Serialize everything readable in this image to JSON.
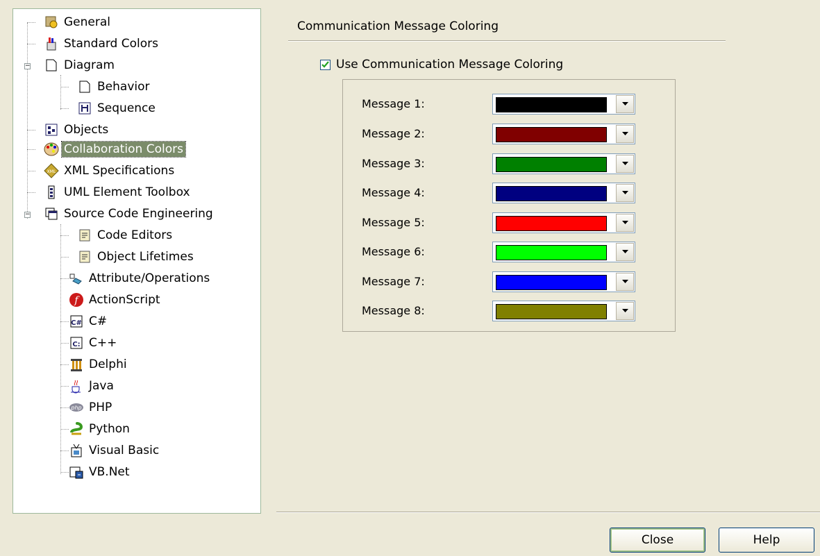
{
  "tree": {
    "items": [
      {
        "label": "General",
        "icon": "general-icon"
      },
      {
        "label": "Standard Colors",
        "icon": "paint-bucket-icon"
      },
      {
        "label": "Diagram",
        "icon": "page-icon"
      },
      {
        "label": "Behavior",
        "icon": "page-icon"
      },
      {
        "label": "Sequence",
        "icon": "sequence-icon"
      },
      {
        "label": "Objects",
        "icon": "objects-icon"
      },
      {
        "label": "Collaboration Colors",
        "icon": "palette-icon"
      },
      {
        "label": "XML Specifications",
        "icon": "xml-icon"
      },
      {
        "label": "UML Element Toolbox",
        "icon": "toolbox-icon"
      },
      {
        "label": "Source Code Engineering",
        "icon": "windows-icon"
      },
      {
        "label": "Code Editors",
        "icon": "code-file-icon"
      },
      {
        "label": "Object Lifetimes",
        "icon": "code-file-icon"
      },
      {
        "label": "Attribute/Operations",
        "icon": "attribute-icon"
      },
      {
        "label": "ActionScript",
        "icon": "flash-icon"
      },
      {
        "label": "C#",
        "icon": "csharp-icon"
      },
      {
        "label": "C++",
        "icon": "cpp-icon"
      },
      {
        "label": "Delphi",
        "icon": "delphi-icon"
      },
      {
        "label": "Java",
        "icon": "java-icon"
      },
      {
        "label": "PHP",
        "icon": "php-icon"
      },
      {
        "label": "Python",
        "icon": "python-icon"
      },
      {
        "label": "Visual Basic",
        "icon": "vb-icon"
      },
      {
        "label": "VB.Net",
        "icon": "vbnet-icon"
      }
    ],
    "selected": "Collaboration Colors"
  },
  "section_title": "Communication Message Coloring",
  "use_coloring": {
    "label": "Use Communication Message Coloring",
    "checked": true
  },
  "messages": [
    {
      "label": "Message 1:",
      "color": "#000000"
    },
    {
      "label": "Message 2:",
      "color": "#800000"
    },
    {
      "label": "Message 3:",
      "color": "#008000"
    },
    {
      "label": "Message 4:",
      "color": "#000080"
    },
    {
      "label": "Message 5:",
      "color": "#ff0000"
    },
    {
      "label": "Message 6:",
      "color": "#00ff00"
    },
    {
      "label": "Message 7:",
      "color": "#0000ff"
    },
    {
      "label": "Message 8:",
      "color": "#808000"
    }
  ],
  "buttons": {
    "close": "Close",
    "help": "Help"
  }
}
